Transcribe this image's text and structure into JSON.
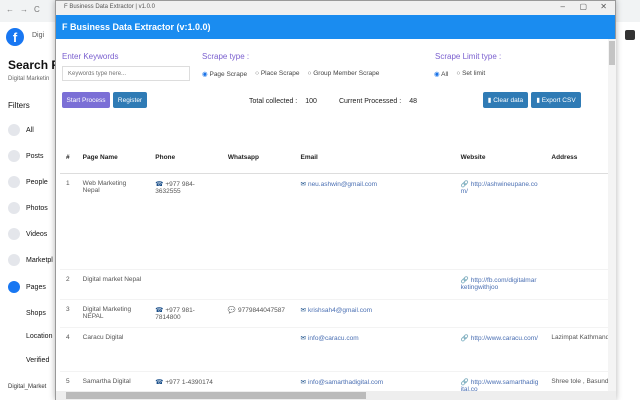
{
  "browser": {
    "search_text": "Digi"
  },
  "fb": {
    "title": "Search Re",
    "subtitle": "Digital Marketin",
    "filters": "Filters",
    "items": [
      "All",
      "Posts",
      "People",
      "Photos",
      "Videos",
      "Marketpl",
      "Pages",
      "Shops",
      "Location",
      "Verified"
    ],
    "bottom": "Digital_Market"
  },
  "window": {
    "titlebar": "F Business Data Extractor | v1.0.0",
    "header": "F Business Data Extractor (v:1.0.0)"
  },
  "form": {
    "keywords_label": "Enter Keywords",
    "keywords_placeholder": "Keywords type here...",
    "scrape_type_label": "Scrape type :",
    "scrape_types": [
      "Page Scrape",
      "Place Scrape",
      "Group Member Scrape"
    ],
    "limit_label": "Scrape Limit type :",
    "limit_types": [
      "All",
      "Set limit"
    ],
    "start": "Start Process",
    "register": "Register",
    "clear": "Clear data",
    "export": "Export CSV",
    "total_label": "Total collected :",
    "total": "100",
    "processed_label": "Current Processed :",
    "processed": "48"
  },
  "colors": {
    "header": "#1a8cf0",
    "start_btn": "#7b6fd6",
    "btn": "#2f7bb5"
  },
  "table": {
    "headers": [
      "#",
      "Page Name",
      "Phone",
      "Whatsapp",
      "Email",
      "Website",
      "Address"
    ],
    "rows": [
      [
        "1",
        "Web Marketing Nepal",
        "+977 984-3632555",
        "",
        "neu.ashwin@gmail.com",
        "http://ashwineupane.com/",
        ""
      ],
      [
        "2",
        "Digital market Nepal",
        "",
        "",
        "",
        "http://fb.com/digitalmarketingwithjoo",
        ""
      ],
      [
        "3",
        "Digital Marketing NEPAL",
        "+977 981-7814800",
        "9779844047587",
        "krishsah4@gmail.com",
        "",
        ""
      ],
      [
        "4",
        "Caracu Digital",
        "",
        "",
        "info@caracu.com",
        "http://www.caracu.com/",
        "Lazimpat Kathmand"
      ],
      [
        "5",
        "Samartha Digital",
        "+977 1-4390174",
        "",
        "info@samarthadigital.com",
        "http://www.samarthadigital.co",
        "Shree tole , Basund"
      ]
    ]
  }
}
